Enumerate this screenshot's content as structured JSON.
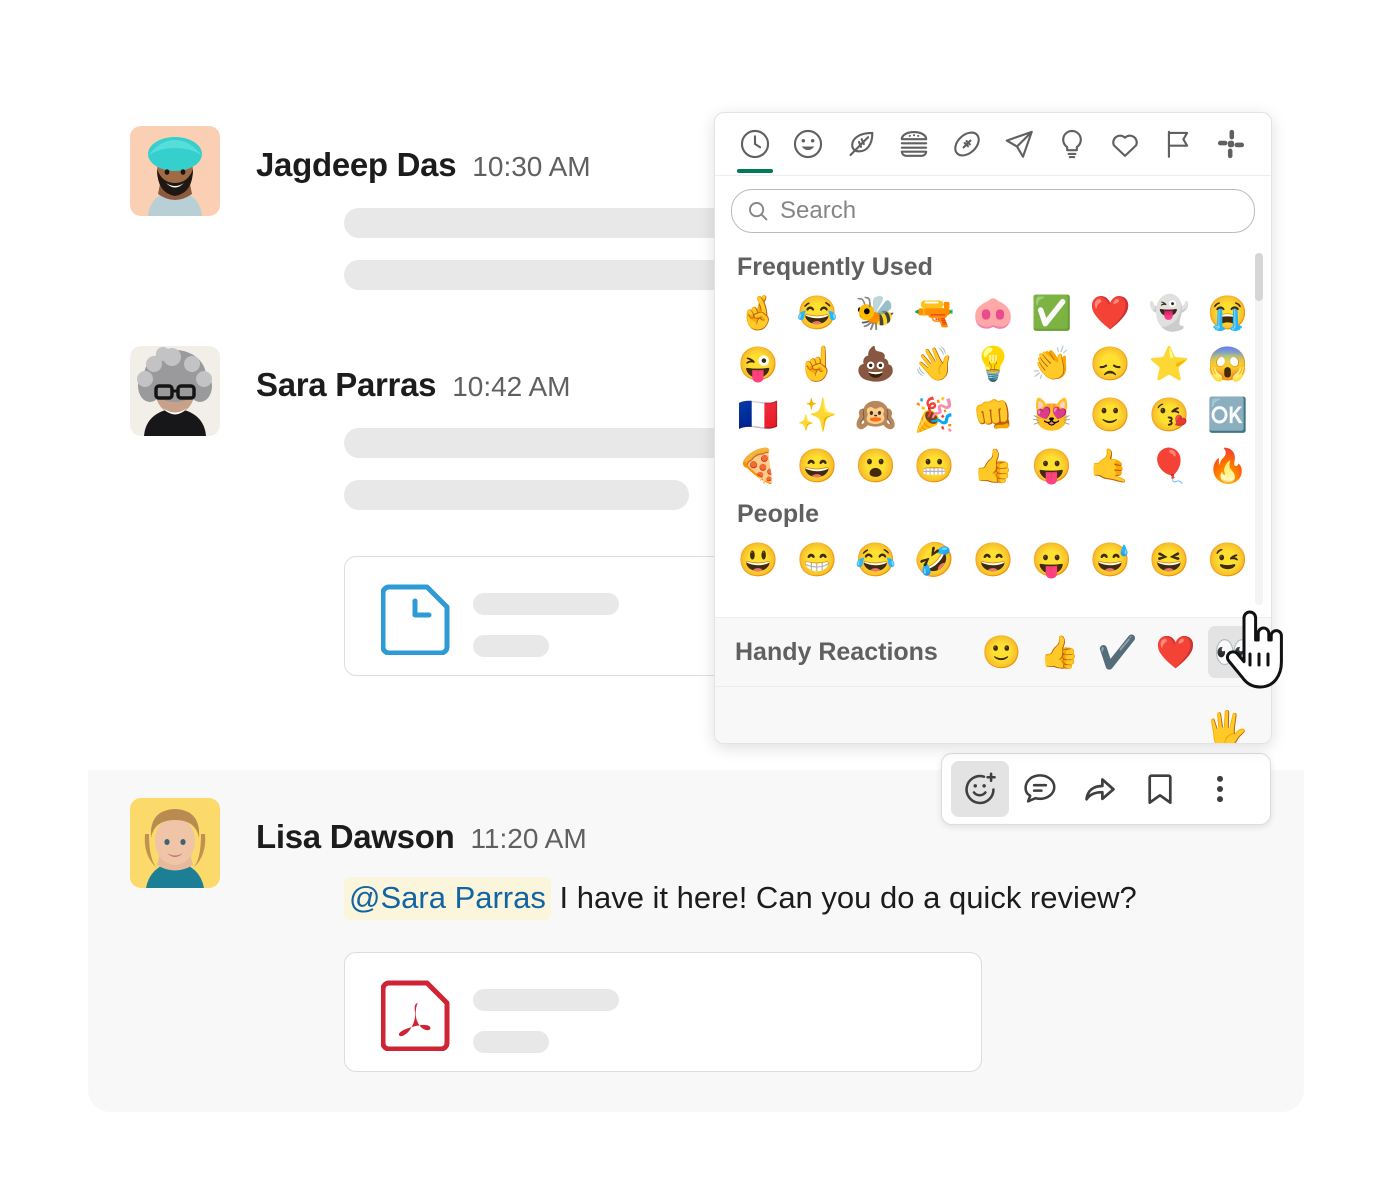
{
  "window": {
    "title": "slack-message-thread"
  },
  "messages": [
    {
      "author": "Jagdeep Das",
      "timestamp": "10:30 AM",
      "avatar_name": "avatar-jagdeep-das",
      "avatar_bg": "#fbcfb4",
      "body_redacted": true,
      "attachment": null
    },
    {
      "author": "Sara Parras",
      "timestamp": "10:42 AM",
      "avatar_name": "avatar-sara-parras",
      "avatar_bg": "#f2efe9",
      "body_redacted": true,
      "attachment": {
        "type": "document",
        "icon_name": "document-file-icon",
        "color": "#2e9bd6"
      }
    },
    {
      "author": "Lisa Dawson",
      "timestamp": "11:20 AM",
      "avatar_name": "avatar-lisa-dawson",
      "avatar_bg": "#fbd96b",
      "highlighted": true,
      "mention": "@Sara Parras",
      "text": " I have it here! Can you do a quick review?",
      "attachment": {
        "type": "pdf",
        "icon_name": "pdf-file-icon",
        "color": "#cf2434"
      }
    }
  ],
  "action_toolbar": {
    "buttons": [
      {
        "name": "add-reaction-button",
        "icon": "emoji-plus-icon",
        "active": true
      },
      {
        "name": "reply-in-thread-button",
        "icon": "speech-bubble-icon",
        "active": false
      },
      {
        "name": "forward-message-button",
        "icon": "share-arrow-icon",
        "active": false
      },
      {
        "name": "save-message-button",
        "icon": "bookmark-icon",
        "active": false
      },
      {
        "name": "more-actions-button",
        "icon": "vertical-dots-icon",
        "active": false
      }
    ]
  },
  "emoji_picker": {
    "tabs": [
      {
        "name": "tab-frequently-used",
        "icon": "clock-icon",
        "selected": true
      },
      {
        "name": "tab-smileys",
        "icon": "smiley-icon",
        "selected": false
      },
      {
        "name": "tab-nature",
        "icon": "leaf-icon",
        "selected": false
      },
      {
        "name": "tab-food",
        "icon": "hamburger-icon",
        "selected": false
      },
      {
        "name": "tab-activity",
        "icon": "football-icon",
        "selected": false
      },
      {
        "name": "tab-travel",
        "icon": "airplane-icon",
        "selected": false
      },
      {
        "name": "tab-objects",
        "icon": "lightbulb-icon",
        "selected": false
      },
      {
        "name": "tab-symbols",
        "icon": "heart-icon",
        "selected": false
      },
      {
        "name": "tab-flags",
        "icon": "flag-icon",
        "selected": false
      },
      {
        "name": "tab-custom",
        "icon": "slack-logo-icon",
        "selected": false
      }
    ],
    "selected_tab_color": "#007a5a",
    "search": {
      "placeholder": "Search",
      "value": "",
      "icon": "search-icon"
    },
    "sections": [
      {
        "title": "Frequently Used",
        "emojis": [
          "🤞",
          "😂",
          "🐝",
          "🔫",
          "🐽",
          "✅",
          "❤️",
          "👻",
          "😭",
          "😜",
          "☝️",
          "💩",
          "👋",
          "💡",
          "👏",
          "😞",
          "⭐",
          "😱",
          "🇫🇷",
          "✨",
          "🙉",
          "🎉",
          "👊",
          "😻",
          "🙂",
          "😘",
          "🆗",
          "🍕",
          "😄",
          "😮",
          "😬",
          "👍",
          "😛",
          "🤙",
          "🎈",
          "🔥"
        ]
      },
      {
        "title": "People",
        "emojis": [
          "😃",
          "😁",
          "😂",
          "🤣",
          "😄",
          "😛",
          "😅",
          "😆",
          "😉"
        ]
      }
    ],
    "handy_reactions": {
      "label": "Handy Reactions",
      "emojis": [
        {
          "glyph": "🙂",
          "name": "reaction-slight-smile",
          "hovered": false
        },
        {
          "glyph": "👍",
          "name": "reaction-thumbs-up",
          "hovered": false
        },
        {
          "glyph": "✔️",
          "name": "reaction-check-mark",
          "hovered": false
        },
        {
          "glyph": "❤️",
          "name": "reaction-red-heart",
          "hovered": false
        },
        {
          "glyph": "👀",
          "name": "reaction-eyes",
          "hovered": true
        }
      ]
    },
    "preview": {
      "emoji": "🖐️"
    }
  }
}
